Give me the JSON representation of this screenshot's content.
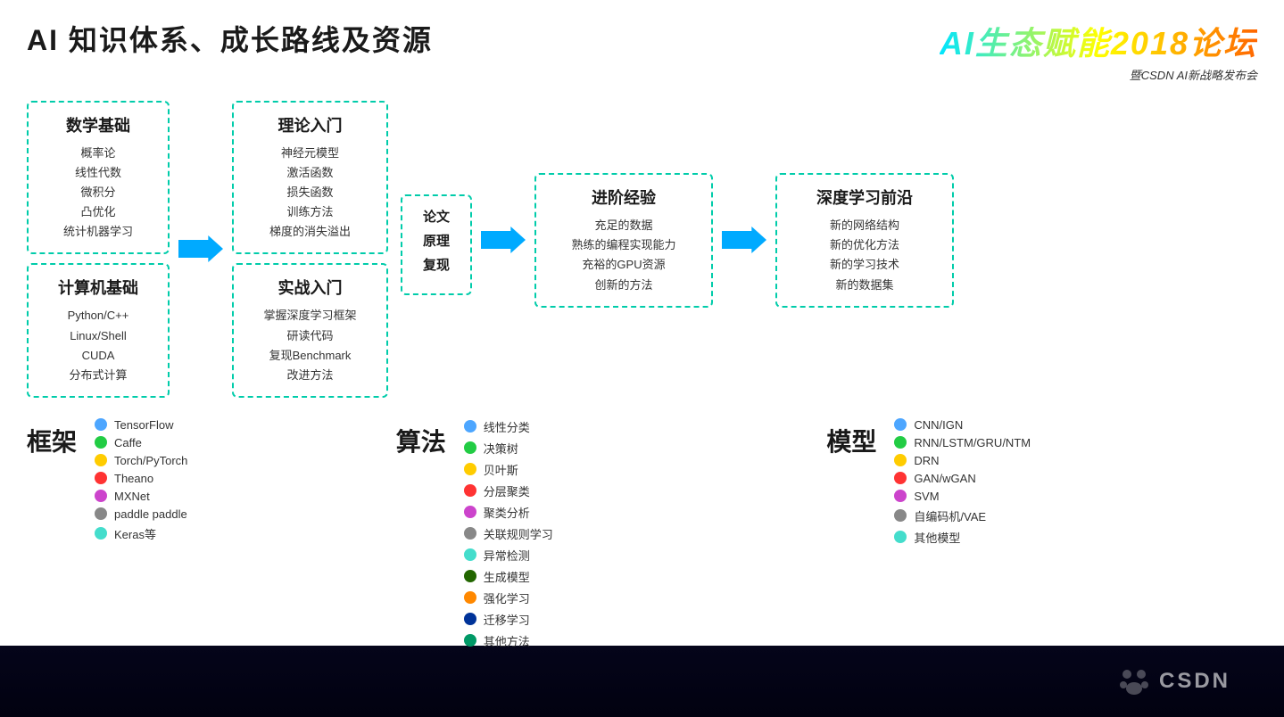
{
  "header": {
    "title": "AI 知识体系、成长路线及资源",
    "logo_main": "AI生态赋能2018论坛",
    "logo_sub": "暨CSDN AI新战略发布会"
  },
  "math_box": {
    "title": "数学基础",
    "items": [
      "概率论",
      "线性代数",
      "微积分",
      "凸优化",
      "统计机器学习"
    ]
  },
  "computer_box": {
    "title": "计算机基础",
    "items": [
      "Python/C++",
      "Linux/Shell",
      "CUDA",
      "分布式计算"
    ]
  },
  "theory_box": {
    "title": "理论入门",
    "items": [
      "神经元模型",
      "激活函数",
      "损失函数",
      "训练方法",
      "梯度的消失溢出"
    ]
  },
  "practice_box": {
    "title": "实战入门",
    "items": [
      "掌握深度学习框架",
      "研读代码",
      "复现Benchmark",
      "改进方法"
    ]
  },
  "paper_box": {
    "lines": [
      "论文",
      "原理",
      "复现"
    ]
  },
  "advanced_box": {
    "title": "进阶经验",
    "items": [
      "充足的数据",
      "熟练的编程实现能力",
      "充裕的GPU资源",
      "创新的方法"
    ]
  },
  "deep_box": {
    "title": "深度学习前沿",
    "items": [
      "新的网络结构",
      "新的优化方法",
      "新的学习技术",
      "新的数据集"
    ]
  },
  "frameworks": {
    "label": "框架",
    "items": [
      {
        "color": "#4da6ff",
        "name": "TensorFlow"
      },
      {
        "color": "#22cc44",
        "name": "Caffe"
      },
      {
        "color": "#ffcc00",
        "name": "Torch/PyTorch"
      },
      {
        "color": "#ff3333",
        "name": "Theano"
      },
      {
        "color": "#cc44cc",
        "name": "MXNet"
      },
      {
        "color": "#888888",
        "name": "paddle paddle"
      },
      {
        "color": "#44ddcc",
        "name": "Keras等"
      }
    ]
  },
  "algorithms": {
    "label": "算法",
    "items": [
      {
        "color": "#4da6ff",
        "name": "线性分类"
      },
      {
        "color": "#22cc44",
        "name": "决策树"
      },
      {
        "color": "#ffcc00",
        "name": "贝叶斯"
      },
      {
        "color": "#ff3333",
        "name": "分层聚类"
      },
      {
        "color": "#cc44cc",
        "name": "聚类分析"
      },
      {
        "color": "#888888",
        "name": "关联规则学习"
      },
      {
        "color": "#44ddcc",
        "name": "异常检测"
      },
      {
        "color": "#226600",
        "name": "生成模型"
      },
      {
        "color": "#ff8800",
        "name": "强化学习"
      },
      {
        "color": "#003399",
        "name": "迁移学习"
      },
      {
        "color": "#009966",
        "name": "其他方法"
      }
    ]
  },
  "models": {
    "label": "模型",
    "items": [
      {
        "color": "#4da6ff",
        "name": "CNN/IGN"
      },
      {
        "color": "#22cc44",
        "name": "RNN/LSTM/GRU/NTM"
      },
      {
        "color": "#ffcc00",
        "name": "DRN"
      },
      {
        "color": "#ff3333",
        "name": "GAN/wGAN"
      },
      {
        "color": "#cc44cc",
        "name": "SVM"
      },
      {
        "color": "#888888",
        "name": "自编码机/VAE"
      },
      {
        "color": "#44ddcc",
        "name": "其他模型"
      }
    ]
  },
  "csdn": {
    "text": "CSDN"
  }
}
